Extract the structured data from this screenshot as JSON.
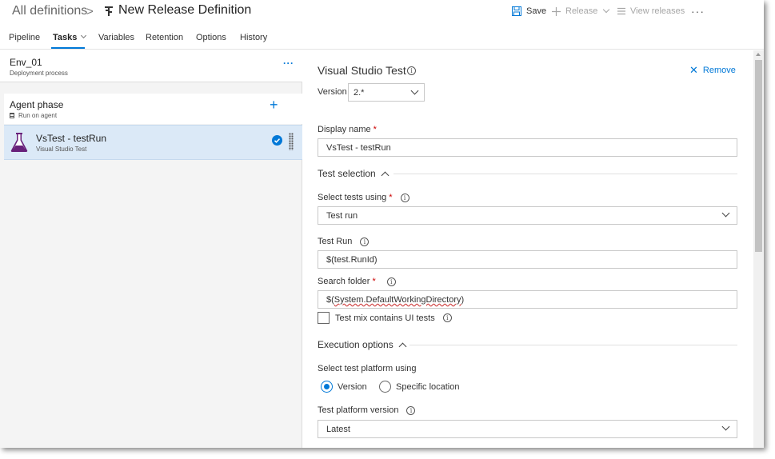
{
  "header": {
    "breadcrumb_root": "All definitions",
    "breadcrumb_separator": ">",
    "title": "New Release Definition",
    "toolbar": {
      "save_label": "Save",
      "release_label": "Release",
      "view_releases_label": "View releases",
      "more_label": "···"
    }
  },
  "tabs": [
    {
      "label": "Pipeline"
    },
    {
      "label": "Tasks",
      "active": true
    },
    {
      "label": "Variables"
    },
    {
      "label": "Retention"
    },
    {
      "label": "Options"
    },
    {
      "label": "History"
    }
  ],
  "left_panel": {
    "environment": {
      "name": "Env_01",
      "subtitle": "Deployment process",
      "more_label": "···"
    },
    "phase": {
      "name": "Agent phase",
      "subtitle": "Run on agent",
      "add_label": "+"
    },
    "task": {
      "name": "VsTest - testRun",
      "subtitle": "Visual Studio Test"
    }
  },
  "right_panel": {
    "title": "Visual Studio Test",
    "remove_label": "Remove",
    "version": {
      "label": "Version",
      "value": "2.*"
    },
    "display_name": {
      "label": "Display name",
      "value": "VsTest - testRun"
    },
    "test_selection": {
      "heading": "Test selection",
      "select_tests_using": {
        "label": "Select tests using",
        "value": "Test run"
      },
      "test_run": {
        "label": "Test Run",
        "value": "$(test.RunId)"
      },
      "search_folder": {
        "label": "Search folder",
        "value_prefix": "$(",
        "value_link": "System.DefaultWorkingDirectory",
        "value_suffix": ")"
      },
      "ui_tests_checkbox": {
        "label": "Test mix contains UI tests",
        "checked": false
      }
    },
    "execution_options": {
      "heading": "Execution options",
      "platform_using": {
        "label": "Select test platform using",
        "options": [
          {
            "label": "Version",
            "selected": true
          },
          {
            "label": "Specific location",
            "selected": false
          }
        ]
      },
      "platform_version": {
        "label": "Test platform version",
        "value": "Latest"
      }
    },
    "required_mark": "*",
    "info_glyph": "i"
  },
  "icons": {
    "definition": "release-definition-icon",
    "save": "save-icon",
    "release": "plus-icon",
    "view_releases": "list-icon",
    "task": "flask-icon",
    "check": "checkmark-circle-icon",
    "remove": "close-icon"
  },
  "colors": {
    "accent": "#0078d7",
    "task_selected_bg": "#dbe9f7",
    "flask": "#68217a",
    "required": "#c00000"
  }
}
